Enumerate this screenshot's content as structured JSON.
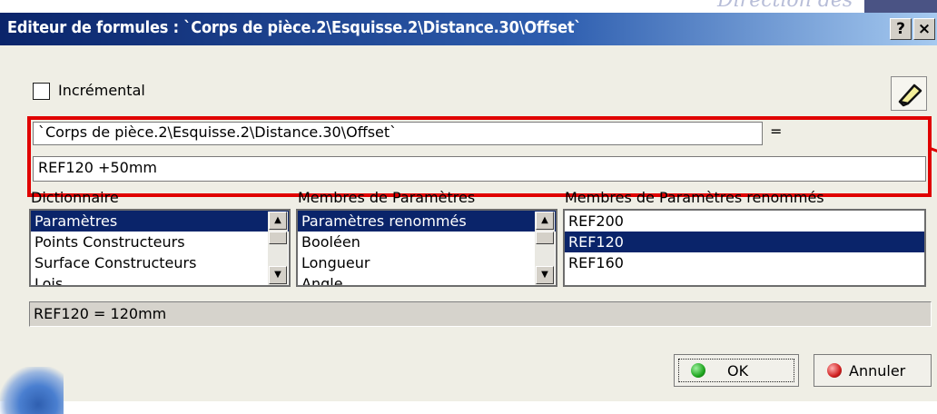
{
  "window": {
    "title": "Editeur de formules : `Corps de pièce.2\\Esquisse.2\\Distance.30\\Offset`",
    "help_label": "?",
    "close_label": "×"
  },
  "background": {
    "text": "Direction des"
  },
  "incremental": {
    "label": "Incrémental",
    "checked": false
  },
  "formula": {
    "parameter": "`Corps de pièce.2\\Esquisse.2\\Distance.30\\Offset`",
    "equals": "=",
    "value": "REF120 +50mm"
  },
  "columns": [
    {
      "header": "Dictionnaire",
      "items": [
        "Paramètres",
        "Points Constructeurs",
        "Surface Constructeurs",
        "Lois"
      ],
      "selected": 0
    },
    {
      "header": "Membres de Paramètres",
      "items": [
        "Paramètres renommés",
        "Booléen",
        "Longueur",
        "Angle"
      ],
      "selected": 0
    },
    {
      "header": "Membres de Paramètres renommés",
      "items": [
        "REF200",
        "REF120",
        "REF160"
      ],
      "selected": 1
    }
  ],
  "status": {
    "text": "REF120 = 120mm"
  },
  "buttons": {
    "ok": "OK",
    "cancel": "Annuler"
  },
  "colors": {
    "selection": "#0a246a",
    "highlight_box": "#e00000",
    "ok_dot": "#1fa61f",
    "cancel_dot": "#d02020"
  }
}
